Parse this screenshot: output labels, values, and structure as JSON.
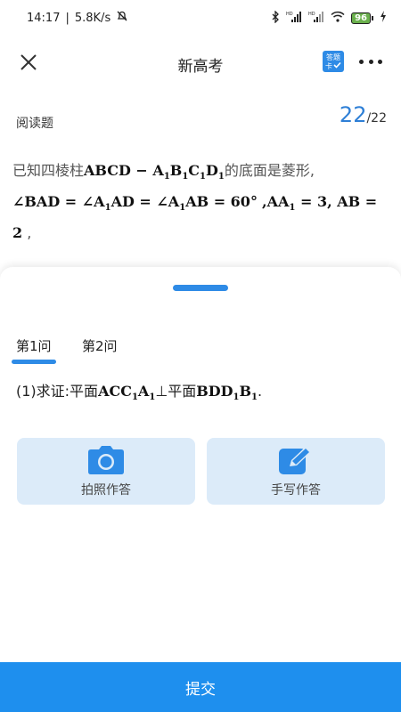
{
  "status_bar": {
    "time": "14:17",
    "net_speed": "5.8K/s",
    "signal_tag_1": "HD",
    "signal_tag_2": "HD",
    "battery": "96"
  },
  "header": {
    "title": "新高考",
    "answer_card_line1": "答题",
    "answer_card_line2": "卡"
  },
  "question": {
    "type": "阅读题",
    "current_page": "22",
    "total_pages": "/22",
    "text_prefix": "已知四棱柱",
    "text_suffix": "的底面是菱形,"
  },
  "tabs": [
    {
      "label": "第1问",
      "active": true
    },
    {
      "label": "第2问",
      "active": false
    }
  ],
  "sub_question": {
    "prefix": "(1)求证:平面",
    "middle": "⊥平面",
    "suffix": "."
  },
  "answer_options": {
    "photo_label": "拍照作答",
    "handwrite_label": "手写作答"
  },
  "submit_label": "提交",
  "colors": {
    "accent": "#2e8be6",
    "submit_bg": "#1e8fee",
    "option_bg": "#dcebf9",
    "counter": "#2e7fd6"
  }
}
